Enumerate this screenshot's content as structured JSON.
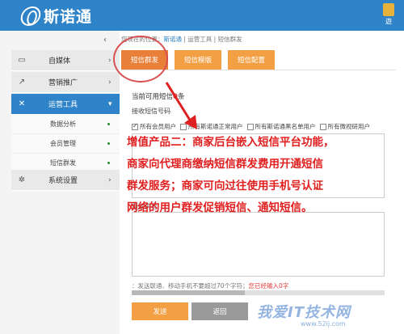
{
  "header": {
    "logo_text": "斯诺通",
    "user_label": "遊"
  },
  "sidebar": {
    "collapse_icon": "‹",
    "items": [
      {
        "label": "自媒体",
        "icon": "monitor-icon",
        "glyph": "▭"
      },
      {
        "label": "营销推广",
        "icon": "megaphone-icon",
        "glyph": "↗"
      },
      {
        "label": "运营工具",
        "icon": "tools-icon",
        "glyph": "✕"
      },
      {
        "label": "系统设置",
        "icon": "gear-icon",
        "glyph": "✲"
      }
    ],
    "subitems": [
      {
        "label": "数据分析"
      },
      {
        "label": "会员管理"
      },
      {
        "label": "短信群发"
      }
    ]
  },
  "breadcrumb": {
    "prefix": "您现在的位置：",
    "home": "斯诺通",
    "sep1": " | ",
    "section": "运营工具",
    "sep2": " | ",
    "page": "短信群发"
  },
  "tabs": [
    {
      "label": "短信群发"
    },
    {
      "label": "短信模版"
    },
    {
      "label": "短信配置"
    }
  ],
  "form": {
    "available_prefix": "当前可用短信",
    "available_count": "0",
    "available_unit": "条",
    "receiver_label": "接收短信号码",
    "checkboxes": [
      {
        "label": "所有会员用户",
        "checked": true
      },
      {
        "label": "所有斯诺通正常用户",
        "checked": false
      },
      {
        "label": "所有斯诺通黑名单用户",
        "checked": false
      },
      {
        "label": "所有微视研用户",
        "checked": false
      }
    ],
    "content_label": "短信内容",
    "hint_text": "：发送联通、移动手机不要超过70个字符；",
    "hint_red": "您已经输入0字",
    "send_label": "发送",
    "back_label": "返回"
  },
  "annotation": {
    "lines": [
      "增值产品二：商家后台嵌入短信平台功能，",
      "商家向代理商缴纳短信群发费用开通短信",
      "群发服务；商家可向过往使用手机号认证",
      "网络的用户群发促销短信、通知短信。"
    ]
  },
  "watermark": {
    "text": "我爱IT技术网",
    "url": "www.52ij.com"
  }
}
